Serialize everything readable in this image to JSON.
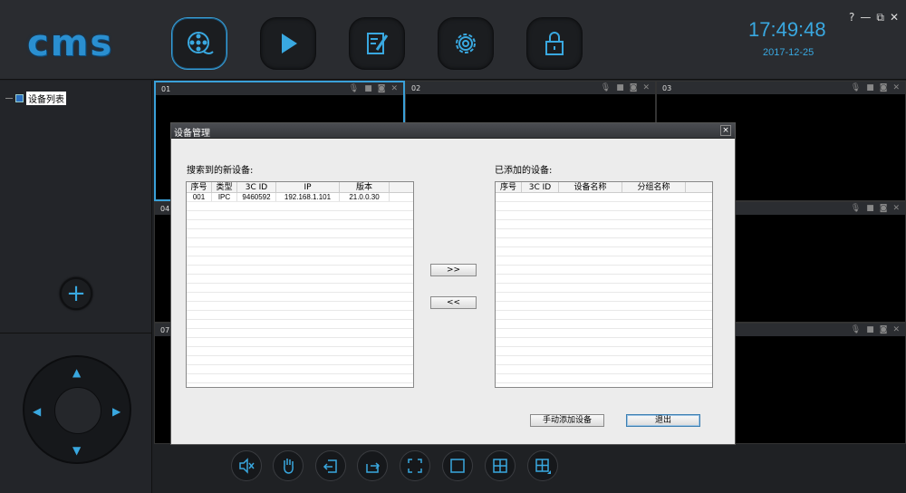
{
  "app": {
    "logo_text": "cms",
    "time": "17:49:48",
    "date": "2017-12-25",
    "window_controls": [
      "?",
      "—",
      "⧉",
      "✕"
    ]
  },
  "nav": [
    {
      "name": "live-view-nav-button",
      "icon": "film-reel-icon",
      "active": true
    },
    {
      "name": "playback-nav-button",
      "icon": "play-icon",
      "active": false
    },
    {
      "name": "log-nav-button",
      "icon": "edit-document-icon",
      "active": false
    },
    {
      "name": "settings-nav-button",
      "icon": "gear-icon",
      "active": false
    },
    {
      "name": "lock-nav-button",
      "icon": "lock-icon",
      "active": false
    }
  ],
  "sidebar": {
    "device_tree_label": "设备列表",
    "add_button": "+",
    "ptz": {
      "up": "▲",
      "down": "▼",
      "left": "◀",
      "right": "▶"
    }
  },
  "video_cells": [
    "01",
    "02",
    "03",
    "04",
    "",
    "",
    "07",
    "",
    ""
  ],
  "dialog": {
    "title": "设备管理",
    "close": "×",
    "search_label": "搜索到的新设备:",
    "added_label": "已添加的设备:",
    "search_table": {
      "columns": [
        "序号",
        "类型",
        "3C ID",
        "IP",
        "版本"
      ],
      "rows": [
        [
          "001",
          "IPC",
          "9460592",
          "192.168.1.101",
          "21.0.0.30"
        ]
      ]
    },
    "added_table": {
      "columns": [
        "序号",
        "3C ID",
        "设备名称",
        "分组名称"
      ],
      "rows": []
    },
    "add_button": ">>",
    "remove_button": "<<",
    "manual_add_button": "手动添加设备",
    "exit_button": "退出"
  },
  "toolbar": [
    "mute-icon",
    "hand-icon",
    "import-icon",
    "export-icon",
    "fullscreen-icon",
    "layout-1-icon",
    "layout-4-icon",
    "layout-custom-icon"
  ],
  "colors": {
    "accent": "#39a8e0",
    "background": "#1f2124",
    "dialog": "#ececec"
  }
}
